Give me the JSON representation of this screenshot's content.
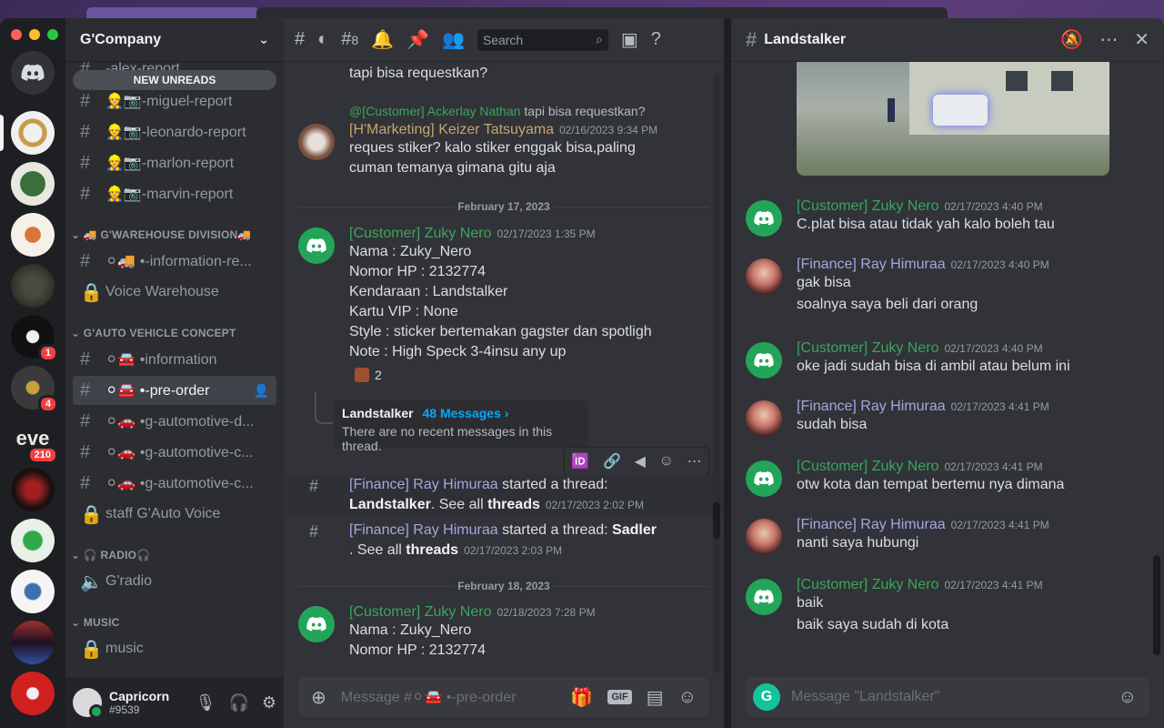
{
  "server": {
    "name": "G'Company",
    "new_unreads": "NEW UNREADS",
    "badges": [
      "1",
      "4",
      "210"
    ]
  },
  "channels": {
    "top_cutoff": "-alex-report",
    "report_channels": [
      {
        "label": "👷📷-miguel-report"
      },
      {
        "label": "👷📷-leonardo-report"
      },
      {
        "label": "👷📷-marlon-report"
      },
      {
        "label": "👷📷-marvin-report"
      }
    ],
    "cat_warehouse": "🚚 G'WAREHOUSE DIVISION🚚",
    "warehouse": [
      {
        "label": "⚪🚚 •-information-re..."
      },
      {
        "label": "Voice Warehouse"
      }
    ],
    "cat_auto": "G'AUTO VEHICLE CONCEPT",
    "auto": [
      {
        "label": "⚪🚘 •information"
      },
      {
        "label": "⚪🚘 •-pre-order"
      },
      {
        "label": "⚪🚗 •g-automotive-d..."
      },
      {
        "label": "⚪🚗 •g-automotive-c..."
      },
      {
        "label": "⚪🚗 •g-automotive-c..."
      },
      {
        "label": "staff G'Auto Voice"
      }
    ],
    "cat_radio": "🎧 RADIO🎧",
    "radio": [
      {
        "label": "G'radio"
      }
    ],
    "cat_music": "MUSIC",
    "music": [
      {
        "label": "music"
      }
    ]
  },
  "user": {
    "name": "Capricorn",
    "tag": "#9539"
  },
  "toolbar": {
    "thread_count": "8",
    "search_placeholder": "Search"
  },
  "main": {
    "msg0_text": "tapi bisa requestkan?",
    "reply_prefix": "@[Customer] Ackerlay Nathan",
    "reply_text": "tapi bisa requestkan?",
    "msg1_author": "[H'Marketing] Keizer Tatsuyama",
    "msg1_ts": "02/16/2023 9:34 PM",
    "msg1_line1": "reques stiker? kalo stiker enggak bisa,paling",
    "msg1_line2": "cuman temanya gimana gitu aja",
    "date1": "February 17, 2023",
    "msg2_author": "[Customer] Zuky Nero",
    "msg2_ts": "02/17/2023 1:35 PM",
    "msg2_lines": [
      "Nama : Zuky_Nero",
      "Nomor HP : 2132774",
      "Kendaraan : Landstalker",
      "Kartu VIP : None",
      "Style : sticker bertemakan gagster dan spotligh",
      "Note : High Speck 3-4insu any up"
    ],
    "reaction_count": "2",
    "thread_name": "Landstalker",
    "thread_count_link": "48 Messages ›",
    "thread_empty": "There are no recent messages in this thread.",
    "sys1_author": "[Finance] Ray Himuraa",
    "sys1_action": "started a thread:",
    "sys1_thread": "Landstalker",
    "sys1_see": ". See all",
    "sys1_threads": "threads",
    "sys1_ts": "02/17/2023 2:02 PM",
    "sys2_author": "[Finance] Ray Himuraa",
    "sys2_action": "started a thread:",
    "sys2_thread": "Sadler",
    "sys2_see": ". See all",
    "sys2_threads": "threads",
    "sys2_ts": "02/17/2023 2:03 PM",
    "date2": "February 18, 2023",
    "msg3_author": "[Customer] Zuky Nero",
    "msg3_ts": "02/18/2023 7:28 PM",
    "msg3_lines": [
      "Nama : Zuky_Nero",
      "Nomor HP : 2132774"
    ],
    "composer_placeholder": "Message #⚪🚘 •-pre-order",
    "gif_label": "GIF"
  },
  "thread": {
    "title": "Landstalker",
    "composer_placeholder": "Message \"Landstalker\"",
    "messages": [
      {
        "author": "[Customer] Zuky Nero",
        "ts": "02/17/2023 4:40 PM",
        "lines": [
          "C.plat bisa atau tidak yah kalo boleh tau"
        ]
      },
      {
        "author": "[Finance] Ray Himuraa",
        "ts": "02/17/2023 4:40 PM",
        "lines": [
          "gak bisa",
          "soalnya saya beli dari orang"
        ]
      },
      {
        "author": "[Customer] Zuky Nero",
        "ts": "02/17/2023 4:40 PM",
        "lines": [
          "oke jadi sudah bisa di ambil atau belum ini"
        ]
      },
      {
        "author": "[Finance] Ray Himuraa",
        "ts": "02/17/2023 4:41 PM",
        "lines": [
          "sudah bisa"
        ]
      },
      {
        "author": "[Customer] Zuky Nero",
        "ts": "02/17/2023 4:41 PM",
        "lines": [
          "otw kota dan tempat bertemu nya dimana"
        ]
      },
      {
        "author": "[Finance] Ray Himuraa",
        "ts": "02/17/2023 4:41 PM",
        "lines": [
          "nanti saya hubungi"
        ]
      },
      {
        "author": "[Customer] Zuky Nero",
        "ts": "02/17/2023 4:41 PM",
        "lines": [
          "baik",
          "baik saya sudah di kota"
        ]
      }
    ]
  }
}
